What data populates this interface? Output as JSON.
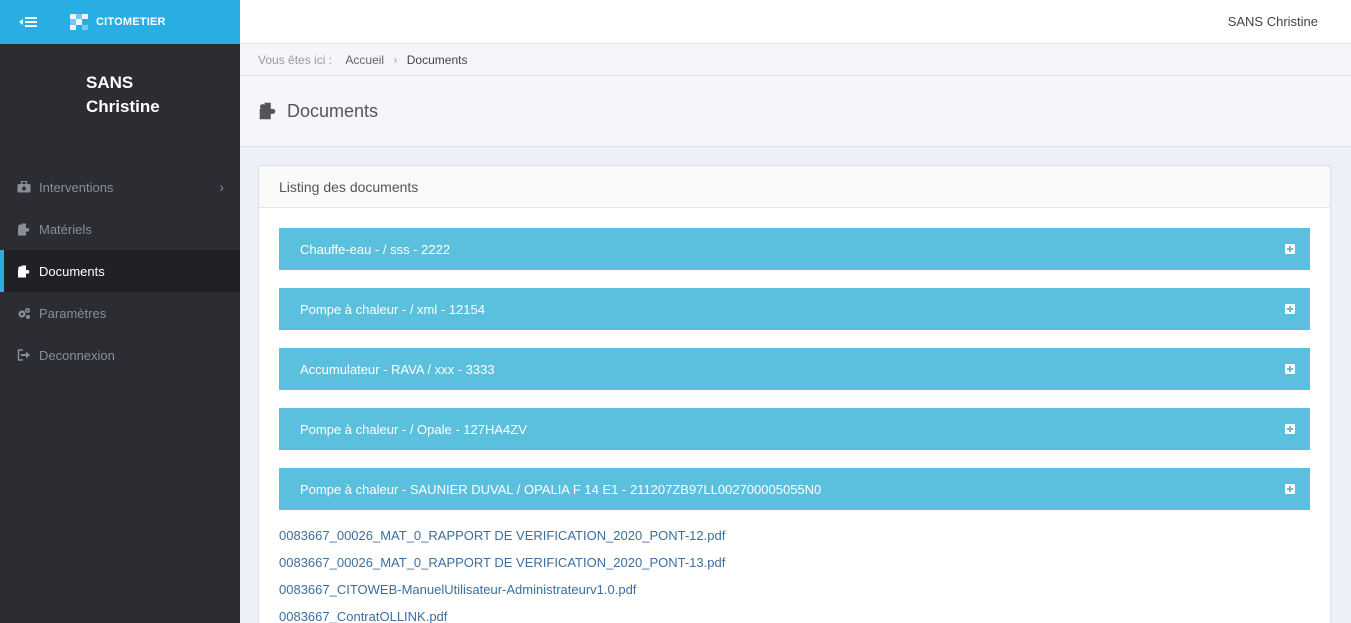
{
  "brand": {
    "name": "CITOMETIER"
  },
  "sidebar": {
    "user_first": "SANS",
    "user_last": "Christine",
    "items": [
      {
        "label": "Interventions",
        "icon": "briefcase-icon",
        "has_submenu": true
      },
      {
        "label": "Matériels",
        "icon": "puzzle-icon"
      },
      {
        "label": "Documents",
        "icon": "puzzle-icon",
        "active": true
      },
      {
        "label": "Paramètres",
        "icon": "gears-icon"
      },
      {
        "label": "Deconnexion",
        "icon": "sign-out-icon"
      }
    ]
  },
  "header": {
    "user_name": "SANS Christine"
  },
  "breadcrumb": {
    "prefix": "Vous êtes ici :",
    "home": "Accueil",
    "current": "Documents"
  },
  "page": {
    "title": "Documents"
  },
  "panel": {
    "heading": "Listing des documents",
    "accordions": [
      "Chauffe-eau - / sss - 2222",
      "Pompe à chaleur - / xml - 12154",
      "Accumulateur - RAVA / xxx - 3333",
      "Pompe à chaleur - / Opale - 127HA4ZV",
      "Pompe à chaleur - SAUNIER DUVAL / OPALIA F 14 E1 - 211207ZB97LL002700005055N0"
    ],
    "documents": [
      "0083667_00026_MAT_0_RAPPORT DE VERIFICATION_2020_PONT-12.pdf",
      "0083667_00026_MAT_0_RAPPORT DE VERIFICATION_2020_PONT-13.pdf",
      "0083667_CITOWEB-ManuelUtilisateur-Administrateurv1.0.pdf",
      "0083667_ContratOLLINK.pdf"
    ]
  },
  "colors": {
    "accent": "#29aee3",
    "accordion": "#5bc0de",
    "sidebar": "#2b2d33",
    "link": "#3c6e9e"
  }
}
